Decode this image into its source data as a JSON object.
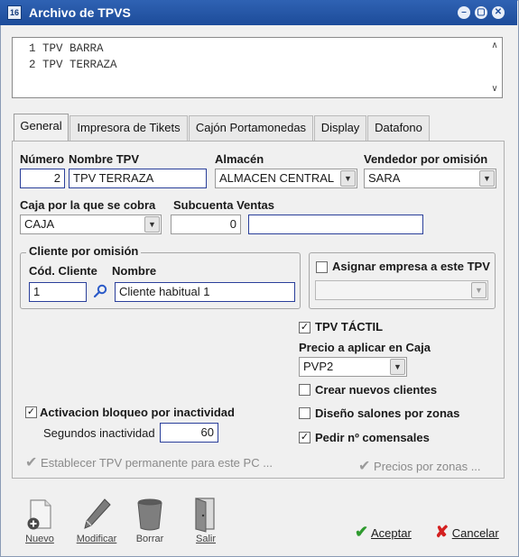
{
  "window": {
    "title": "Archivo de TPVS",
    "title_icon": "16",
    "controls": [
      "–",
      "▢",
      "✕"
    ]
  },
  "list": {
    "items": [
      "1 TPV BARRA",
      "2 TPV TERRAZA"
    ]
  },
  "tabs": [
    {
      "label": "General",
      "active": true
    },
    {
      "label": "Impresora de Tikets",
      "active": false
    },
    {
      "label": "Cajón Portamonedas",
      "active": false
    },
    {
      "label": "Display",
      "active": false
    },
    {
      "label": "Datafono",
      "active": false
    }
  ],
  "form": {
    "numero_label": "Número",
    "numero_value": "2",
    "nombre_label": "Nombre TPV",
    "nombre_value": "TPV TERRAZA",
    "almacen_label": "Almacén",
    "almacen_value": "ALMACEN CENTRAL",
    "vendedor_label": "Vendedor por omisión",
    "vendedor_value": "SARA",
    "caja_label": "Caja por la que se cobra",
    "caja_value": "CAJA",
    "subcuenta_label": "Subcuenta Ventas",
    "subcuenta_value": "0",
    "subcuenta_desc": "",
    "cliente_group_label": "Cliente por omisión",
    "cod_cliente_label": "Cód. Cliente",
    "cod_cliente_value": "1",
    "nombre_cliente_label": "Nombre",
    "nombre_cliente_value": "Cliente habitual 1",
    "asignar_empresa_label": "Asignar empresa a este TPV",
    "asignar_empresa_checked": false,
    "empresa_value": "",
    "tpv_tactil_label": "TPV TÁCTIL",
    "tpv_tactil_checked": true,
    "precio_label": "Precio a aplicar en Caja",
    "precio_value": "PVP2",
    "crear_clientes_label": "Crear nuevos clientes",
    "crear_clientes_checked": false,
    "diseno_salones_label": "Diseño salones por zonas",
    "diseno_salones_checked": false,
    "pedir_comensales_label": "Pedir nº comensales",
    "pedir_comensales_checked": true,
    "activacion_bloqueo_label": "Activacion bloqueo por inactividad",
    "activacion_bloqueo_checked": true,
    "segundos_label": "Segundos inactividad",
    "segundos_value": "60",
    "establecer_tpv_label": "Establecer TPV permanente para este PC ...",
    "precios_zonas_label": "Precios por zonas ..."
  },
  "toolbar": {
    "nuevo": "Nuevo",
    "modificar": "Modificar",
    "borrar": "Borrar",
    "salir": "Salir",
    "aceptar": "Aceptar",
    "cancelar": "Cancelar"
  },
  "colors": {
    "titlebar": "#1d4c9a",
    "input_border": "#2a3f9a",
    "ok_green": "#2e9a2e",
    "cancel_red": "#d42020"
  }
}
